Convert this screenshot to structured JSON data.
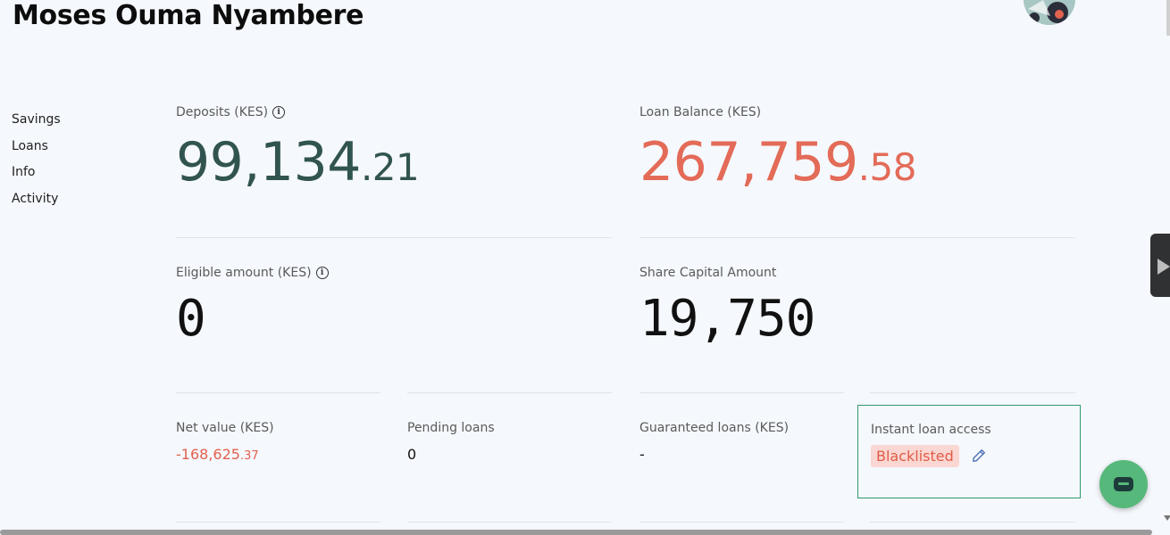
{
  "header": {
    "member_name": "Moses Ouma Nyambere",
    "avatar_icon": "user-avatar-photo"
  },
  "sidebar": {
    "items": [
      {
        "label": "Savings"
      },
      {
        "label": "Loans"
      },
      {
        "label": "Info"
      },
      {
        "label": "Activity"
      }
    ]
  },
  "stats": {
    "deposits": {
      "label": "Deposits (KES)",
      "whole": "99,134",
      "cents": ".21",
      "info_icon": "info-icon"
    },
    "loan_balance": {
      "label": "Loan Balance (KES)",
      "whole": "267,759",
      "cents": ".58"
    },
    "eligible_amount": {
      "label": "Eligible amount (KES)",
      "value": "0",
      "info_icon": "info-icon"
    },
    "share_capital": {
      "label": "Share Capital Amount",
      "value": "19,750"
    },
    "net_value": {
      "label": "Net value (KES)",
      "whole": "-168,625",
      "cents": ".37"
    },
    "pending_loans": {
      "label": "Pending loans",
      "value": "0"
    },
    "guaranteed_loans": {
      "label": "Guaranteed loans (KES)",
      "value": "-"
    },
    "instant_loan_access": {
      "label": "Instant loan access",
      "status": "Blacklisted",
      "edit_icon": "pencil-icon"
    }
  },
  "colors": {
    "deposit_value": "#315450",
    "loan_value": "#e36b58",
    "negative_value": "#e2604e",
    "badge_bg": "#fad7d2",
    "badge_text": "#e15b48",
    "box_border": "#2f9a6e",
    "chat_button": "#56b87a"
  },
  "widgets": {
    "chat_icon": "chat-bubble-icon",
    "side_panel_icon": "play-icon"
  }
}
